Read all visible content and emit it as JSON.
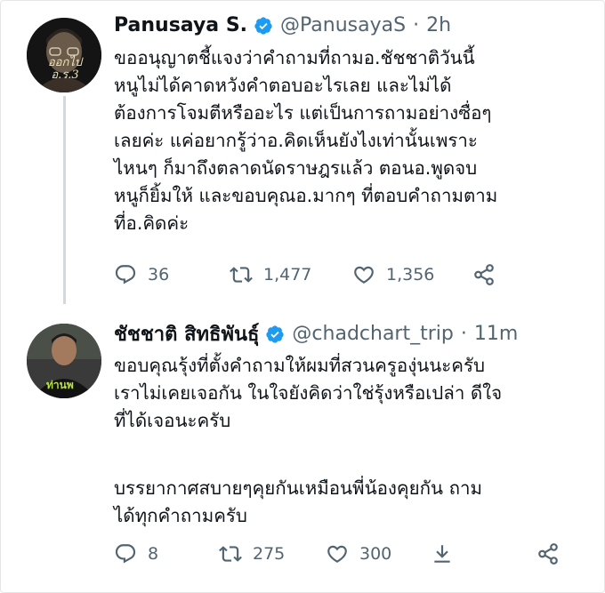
{
  "tweets": [
    {
      "name": "Panusaya S.",
      "handle": "@PanusayaS",
      "separator": "·",
      "time": "2h",
      "avatar_text": "ออกไป\nอ.ร.3",
      "body_lines": [
        "ขออนุญาตชี้แจงว่าคำถามที่ถามอ.ชัชชาติวันนี้",
        "หนูไม่ได้คาดหวังคำตอบอะไรเลย และไม่ได้",
        "ต้องการโจมตีหรืออะไร แต่เป็นการถามอย่างซื่อๆ",
        "เลยค่ะ แค่อยากรู้ว่าอ.คิดเห็นยังไงเท่านั้นเพราะ",
        "ไหนๆ ก็มาถึงตลาดนัดราษฎรแล้ว ตอนอ.พูดจบ",
        "หนูก็ยิ้มให้ และขอบคุณอ.มากๆ ที่ตอบคำถามตาม",
        "ที่อ.คิดค่ะ"
      ],
      "reply_count": "36",
      "retweet_count": "1,477",
      "like_count": "1,356"
    },
    {
      "name": "ชัชชาติ สิทธิพันธุ์",
      "handle": "@chadchart_trip",
      "separator": "·",
      "time": "11m",
      "avatar_text": "ท่านพ",
      "body_paragraph_1": [
        "ขอบคุณรุ้งที่ตั้งคำถามให้ผมที่สวนครูองุ่นนะครับ",
        "เราไม่เคยเจอกัน ในใจยังคิดว่าใช่รุ้งหรือเปล่า ดีใจ",
        "ที่ได้เจอนะครับ"
      ],
      "body_paragraph_2": [
        "บรรยากาศสบายๆคุยกันเหมือนพี่น้องคุยกัน ถาม",
        "ได้ทุกคำถามครับ"
      ],
      "reply_count": "8",
      "retweet_count": "275",
      "like_count": "300"
    }
  ],
  "icons": {
    "verified_color": "#1d9bf0",
    "action_color": "#536471"
  }
}
